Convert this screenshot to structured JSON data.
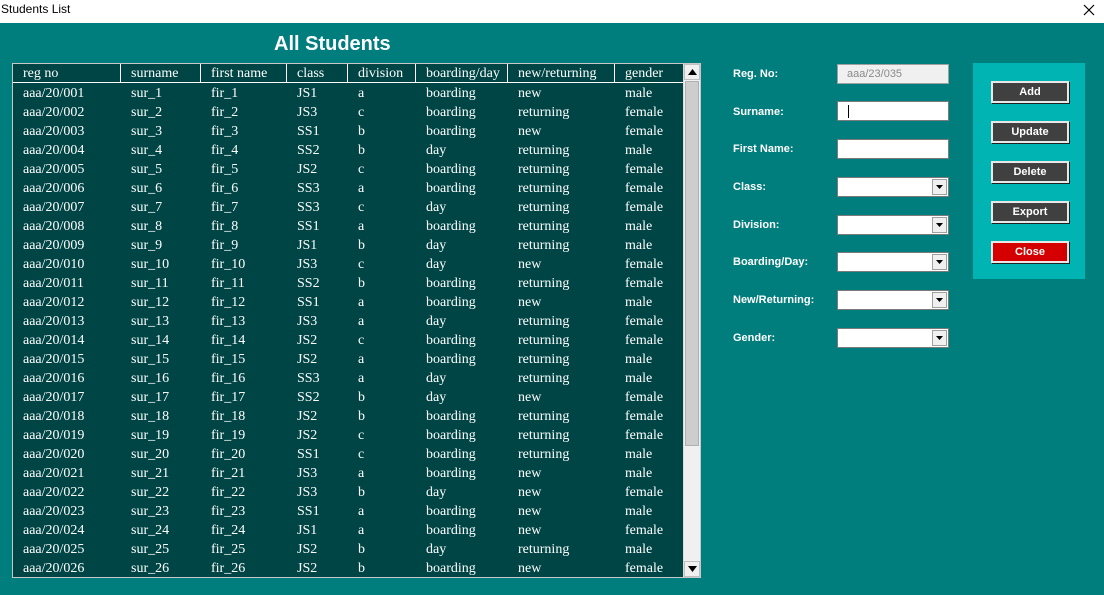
{
  "window": {
    "title": "Students List",
    "close_glyph": "✕"
  },
  "heading": "All Students",
  "table": {
    "columns": [
      "reg no",
      "surname",
      "first name",
      "class",
      "division",
      "boarding/day",
      "new/returning",
      "gender"
    ],
    "rows": [
      [
        "aaa/20/001",
        "sur_1",
        "fir_1",
        "JS1",
        "a",
        "boarding",
        "new",
        "male"
      ],
      [
        "aaa/20/002",
        "sur_2",
        "fir_2",
        "JS3",
        "c",
        "boarding",
        "returning",
        "female"
      ],
      [
        "aaa/20/003",
        "sur_3",
        "fir_3",
        "SS1",
        "b",
        "boarding",
        "new",
        "female"
      ],
      [
        "aaa/20/004",
        "sur_4",
        "fir_4",
        "SS2",
        "b",
        "day",
        "returning",
        "male"
      ],
      [
        "aaa/20/005",
        "sur_5",
        "fir_5",
        "JS2",
        "c",
        "boarding",
        "returning",
        "female"
      ],
      [
        "aaa/20/006",
        "sur_6",
        "fir_6",
        "SS3",
        "a",
        "boarding",
        "returning",
        "female"
      ],
      [
        "aaa/20/007",
        "sur_7",
        "fir_7",
        "SS3",
        "c",
        "day",
        "returning",
        "female"
      ],
      [
        "aaa/20/008",
        "sur_8",
        "fir_8",
        "SS1",
        "a",
        "boarding",
        "returning",
        "male"
      ],
      [
        "aaa/20/009",
        "sur_9",
        "fir_9",
        "JS1",
        "b",
        "day",
        "returning",
        "male"
      ],
      [
        "aaa/20/010",
        "sur_10",
        "fir_10",
        "JS3",
        "c",
        "day",
        "new",
        "female"
      ],
      [
        "aaa/20/011",
        "sur_11",
        "fir_11",
        "SS2",
        "b",
        "boarding",
        "returning",
        "female"
      ],
      [
        "aaa/20/012",
        "sur_12",
        "fir_12",
        "SS1",
        "a",
        "boarding",
        "new",
        "male"
      ],
      [
        "aaa/20/013",
        "sur_13",
        "fir_13",
        "JS3",
        "a",
        "day",
        "returning",
        "female"
      ],
      [
        "aaa/20/014",
        "sur_14",
        "fir_14",
        "JS2",
        "c",
        "boarding",
        "returning",
        "female"
      ],
      [
        "aaa/20/015",
        "sur_15",
        "fir_15",
        "JS2",
        "a",
        "boarding",
        "returning",
        "male"
      ],
      [
        "aaa/20/016",
        "sur_16",
        "fir_16",
        "SS3",
        "a",
        "day",
        "returning",
        "male"
      ],
      [
        "aaa/20/017",
        "sur_17",
        "fir_17",
        "SS2",
        "b",
        "day",
        "new",
        "female"
      ],
      [
        "aaa/20/018",
        "sur_18",
        "fir_18",
        "JS2",
        "b",
        "boarding",
        "returning",
        "female"
      ],
      [
        "aaa/20/019",
        "sur_19",
        "fir_19",
        "JS2",
        "c",
        "boarding",
        "returning",
        "female"
      ],
      [
        "aaa/20/020",
        "sur_20",
        "fir_20",
        "SS1",
        "c",
        "boarding",
        "returning",
        "male"
      ],
      [
        "aaa/20/021",
        "sur_21",
        "fir_21",
        "JS3",
        "a",
        "boarding",
        "new",
        "male"
      ],
      [
        "aaa/20/022",
        "sur_22",
        "fir_22",
        "JS3",
        "b",
        "day",
        "new",
        "female"
      ],
      [
        "aaa/20/023",
        "sur_23",
        "fir_23",
        "SS1",
        "a",
        "boarding",
        "new",
        "male"
      ],
      [
        "aaa/20/024",
        "sur_24",
        "fir_24",
        "JS1",
        "a",
        "boarding",
        "new",
        "female"
      ],
      [
        "aaa/20/025",
        "sur_25",
        "fir_25",
        "JS2",
        "b",
        "day",
        "returning",
        "male"
      ],
      [
        "aaa/20/026",
        "sur_26",
        "fir_26",
        "JS2",
        "b",
        "boarding",
        "new",
        "female"
      ]
    ]
  },
  "form": {
    "reg_no": {
      "label": "Reg. No:",
      "value": "aaa/23/035"
    },
    "surname": {
      "label": "Surname:",
      "value": ""
    },
    "first_name": {
      "label": "First Name:",
      "value": ""
    },
    "class": {
      "label": "Class:",
      "value": ""
    },
    "division": {
      "label": "Division:",
      "value": ""
    },
    "boarding_day": {
      "label": "Boarding/Day:",
      "value": ""
    },
    "new_returning": {
      "label": "New/Returning:",
      "value": ""
    },
    "gender": {
      "label": "Gender:",
      "value": ""
    }
  },
  "buttons": {
    "add": "Add",
    "update": "Update",
    "delete": "Delete",
    "export": "Export",
    "close": "Close"
  },
  "colors": {
    "background": "#007d7d",
    "list_background": "#004545",
    "button_panel": "#00b4b4",
    "button": "#404040",
    "close_button": "#d40000"
  },
  "icons": {
    "window_close": "close-icon",
    "scroll_up": "arrow-up-icon",
    "scroll_down": "arrow-down-icon",
    "dropdown": "chevron-down-icon"
  }
}
